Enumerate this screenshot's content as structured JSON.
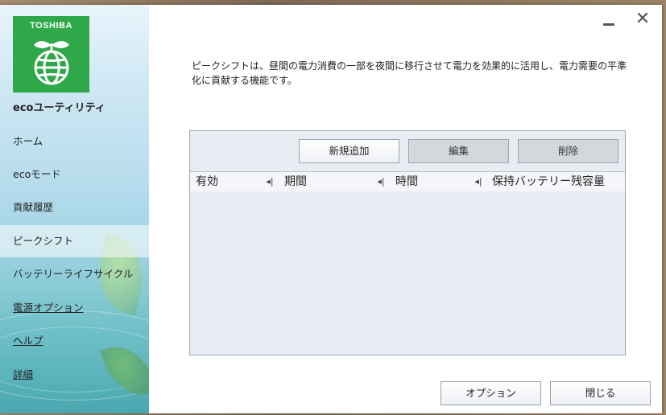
{
  "window": {
    "brand": "TOSHIBA",
    "app_title": "ecoユーティリティ",
    "minimize_label": "",
    "close_label": "✕"
  },
  "sidebar": {
    "items": [
      {
        "label": "ホーム"
      },
      {
        "label": "ecoモード"
      },
      {
        "label": "貢献履歴"
      },
      {
        "label": "ピークシフト"
      },
      {
        "label": "バッテリーライフサイクル"
      },
      {
        "label": "電源オプション"
      },
      {
        "label": "ヘルプ"
      },
      {
        "label": "詳細"
      }
    ],
    "active_index": 3
  },
  "main": {
    "description": "ピークシフトは、昼間の電力消費の一部を夜間に移行させて電力を効果的に活用し、電力需要の平準化に貢献する機能です。",
    "toolbar": {
      "add_label": "新規追加",
      "edit_label": "編集",
      "delete_label": "削除"
    },
    "table": {
      "columns": [
        "有効",
        "期間",
        "時間",
        "保持バッテリー残容量"
      ],
      "rows": []
    },
    "footer": {
      "options_label": "オプション",
      "close_label": "閉じる"
    }
  },
  "colors": {
    "logo_green": "#2fa84a",
    "panel_bg": "#e9edf3"
  }
}
